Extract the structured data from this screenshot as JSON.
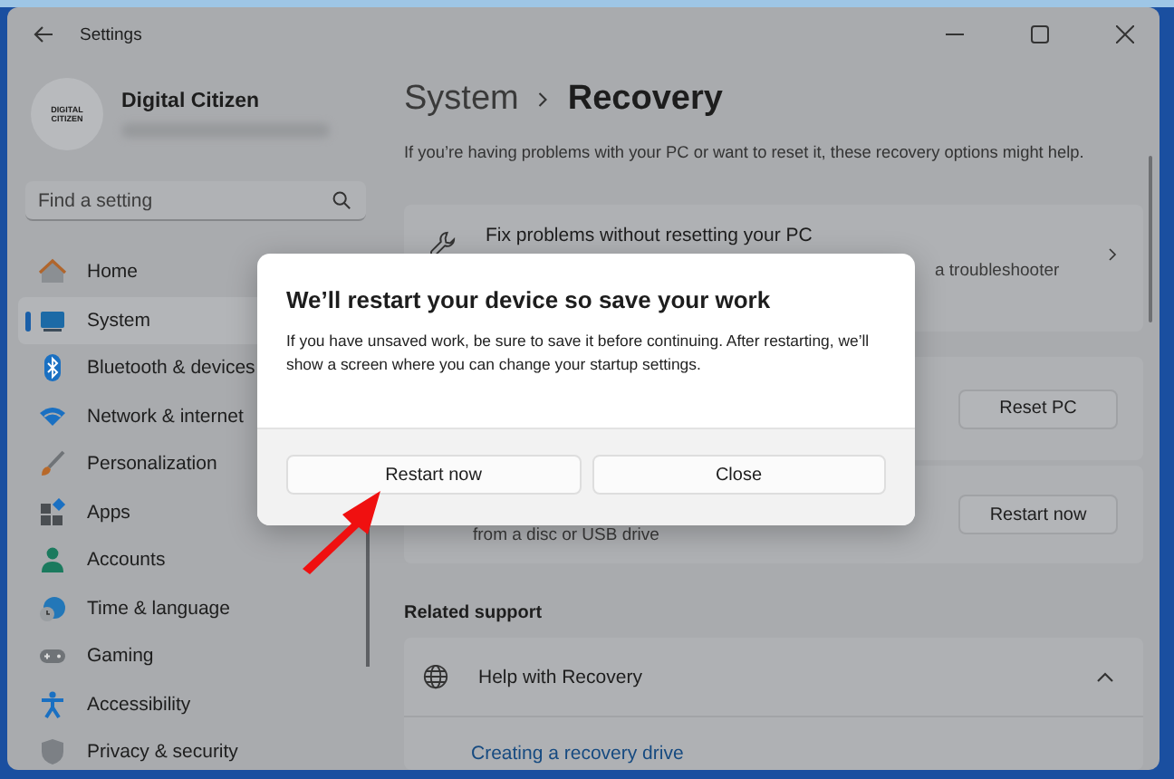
{
  "window": {
    "title": "Settings"
  },
  "profile": {
    "avatar_lines": [
      "DIGITAL",
      "CITIZEN"
    ],
    "name": "Digital Citizen"
  },
  "search": {
    "placeholder": "Find a setting"
  },
  "sidebar": {
    "items": [
      {
        "label": "Home",
        "selected": false
      },
      {
        "label": "System",
        "selected": true
      },
      {
        "label": "Bluetooth & devices",
        "selected": false
      },
      {
        "label": "Network & internet",
        "selected": false
      },
      {
        "label": "Personalization",
        "selected": false
      },
      {
        "label": "Apps",
        "selected": false
      },
      {
        "label": "Accounts",
        "selected": false
      },
      {
        "label": "Time & language",
        "selected": false
      },
      {
        "label": "Gaming",
        "selected": false
      },
      {
        "label": "Accessibility",
        "selected": false
      },
      {
        "label": "Privacy & security",
        "selected": false
      }
    ]
  },
  "breadcrumb": {
    "parent": "System",
    "current": "Recovery"
  },
  "description": "If you’re having problems with your PC or want to reset it, these recovery options might help.",
  "cards": [
    {
      "kind": "link",
      "title": "Fix problems without resetting your PC",
      "subtitle": "a troubleshooter"
    },
    {
      "kind": "button",
      "button": "Reset PC"
    },
    {
      "kind": "button",
      "subtitle": "from a disc or USB drive",
      "button": "Restart now"
    }
  ],
  "related": {
    "heading": "Related support",
    "title": "Help with Recovery",
    "expanded": true,
    "links": [
      "Creating a recovery drive"
    ]
  },
  "dialog": {
    "title": "We’ll restart your device so save your work",
    "body": "If you have unsaved work, be sure to save it before continuing. After restarting, we’ll show a screen where you can change your startup settings.",
    "buttons": [
      {
        "label": "Restart now"
      },
      {
        "label": "Close"
      }
    ]
  }
}
